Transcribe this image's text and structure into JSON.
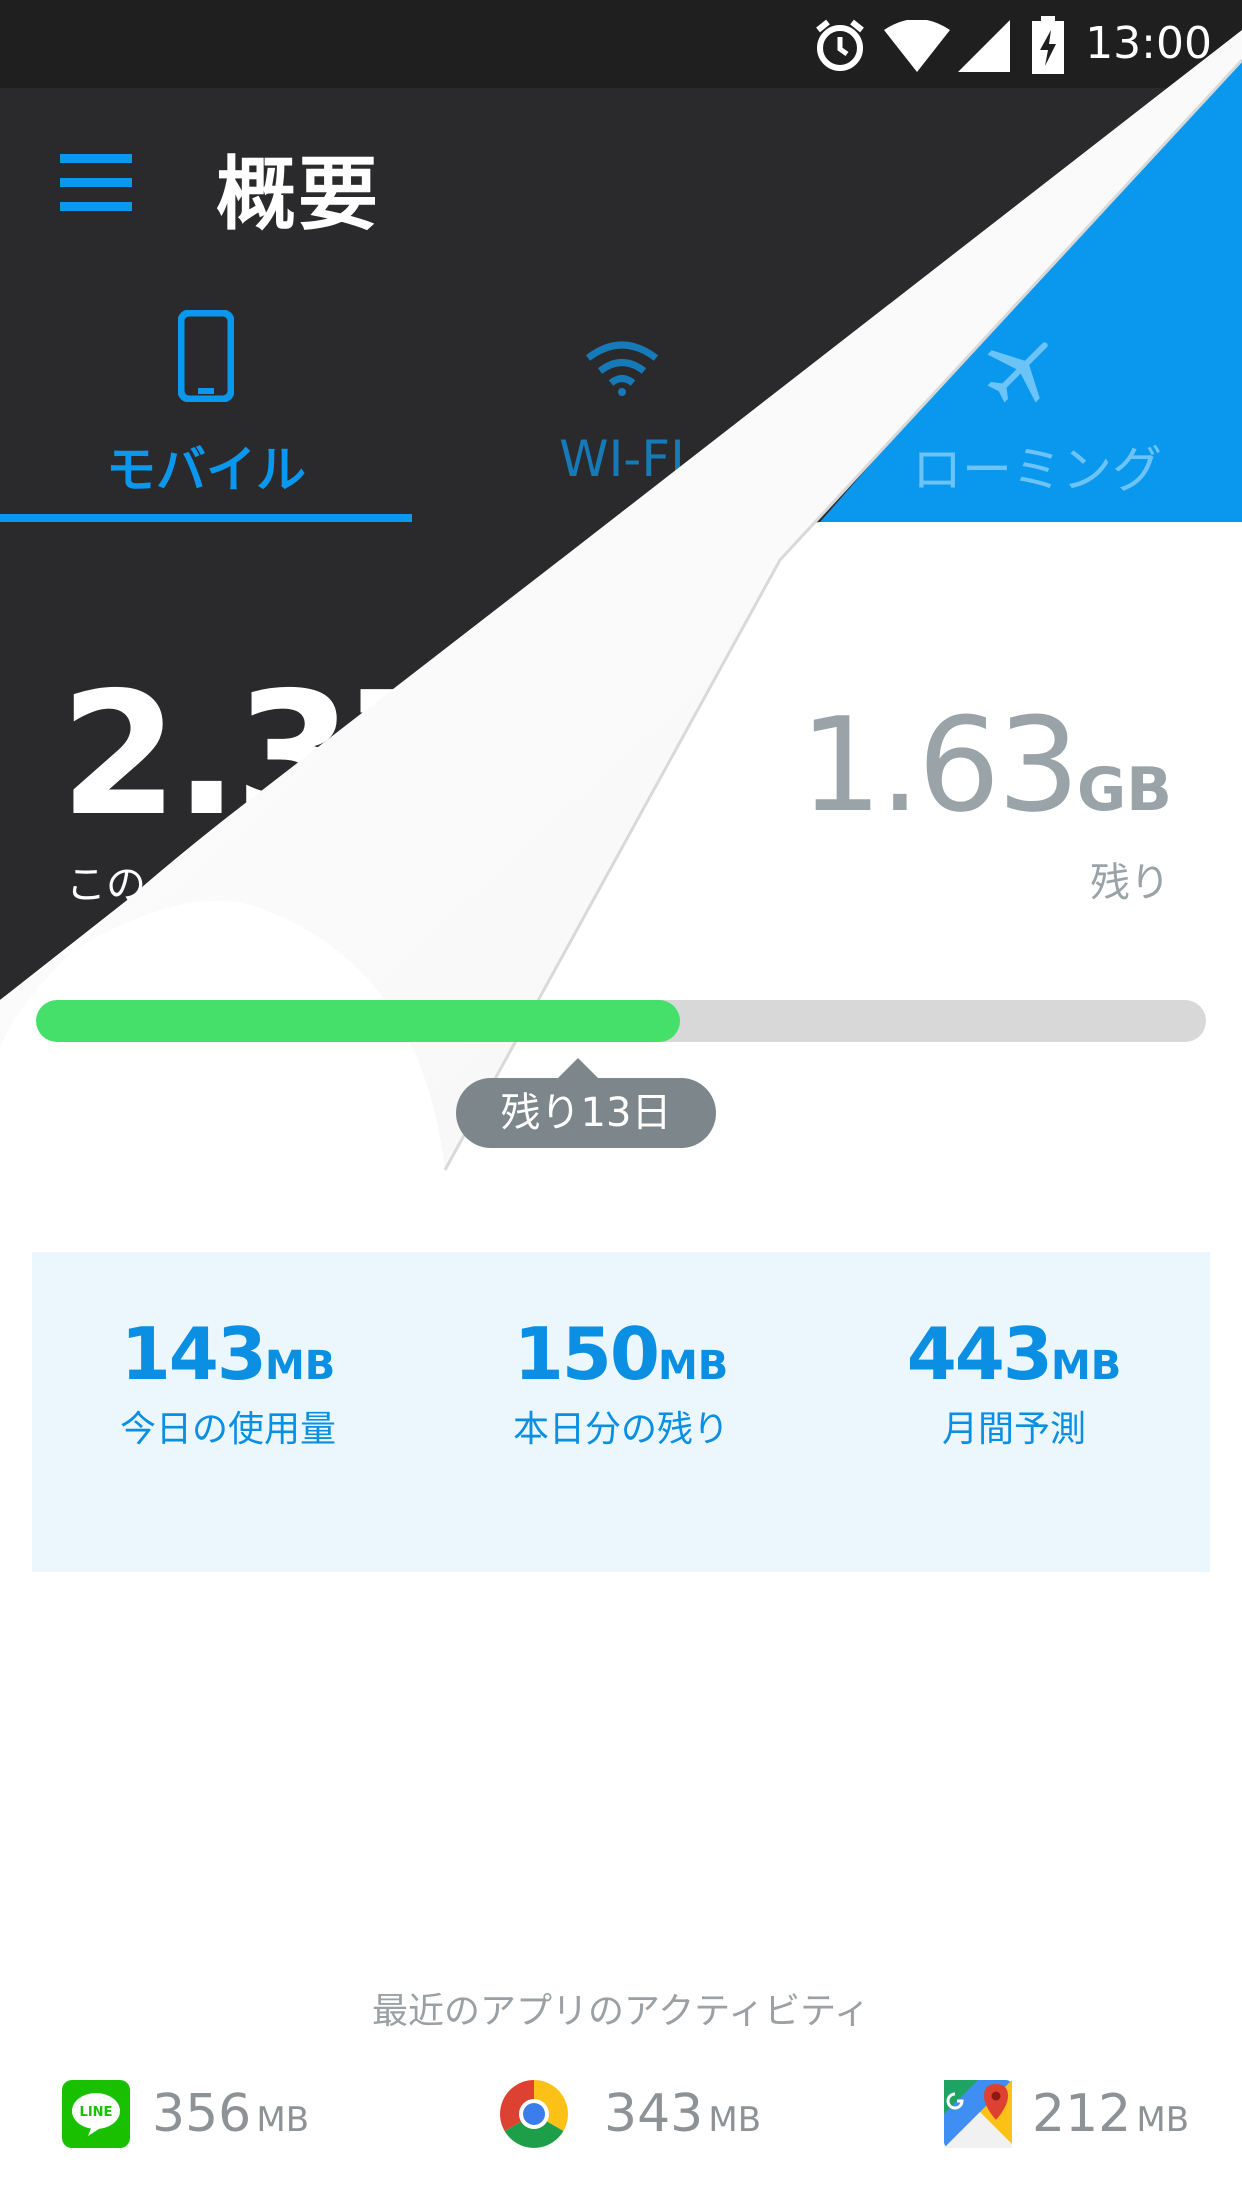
{
  "status_bar": {
    "time": "13:00",
    "icons": [
      "alarm-icon",
      "wifi-signal-icon",
      "cell-signal-icon",
      "battery-charging-icon"
    ]
  },
  "app_bar": {
    "title": "概要",
    "menu_icon": "hamburger-menu-icon"
  },
  "tabs": [
    {
      "label": "モバイル",
      "icon": "phone-icon",
      "selected": true
    },
    {
      "label": "WI-FI",
      "icon": "wifi-icon",
      "selected": false
    },
    {
      "label": "ローミング",
      "icon": "airplane-icon",
      "selected": false
    }
  ],
  "usage": {
    "used_value": "2.37",
    "used_caption": "この",
    "remaining_value": "1.63",
    "remaining_unit": "GB",
    "remaining_caption": "残り",
    "progress_fraction": 0.55,
    "days_left_label": "残り13日"
  },
  "summary": [
    {
      "value": "143",
      "unit": "MB",
      "label": "今日の使用量"
    },
    {
      "value": "150",
      "unit": "MB",
      "label": "本日分の残り"
    },
    {
      "value": "443",
      "unit": "MB",
      "label": "月間予測"
    }
  ],
  "recent": {
    "title": "最近のアプリのアクティビティ",
    "apps": [
      {
        "icon": "line-app-icon",
        "icon_text": "LINE",
        "value": "356",
        "unit": "MB"
      },
      {
        "icon": "chrome-app-icon",
        "value": "343",
        "unit": "MB"
      },
      {
        "icon": "google-maps-app-icon",
        "value": "212",
        "unit": "MB"
      }
    ]
  },
  "colors": {
    "accent_blue": "#0a97ee",
    "dark_bg": "#2a2a2c",
    "progress_green": "#45e06a",
    "summary_bg": "#ebf6fd"
  }
}
